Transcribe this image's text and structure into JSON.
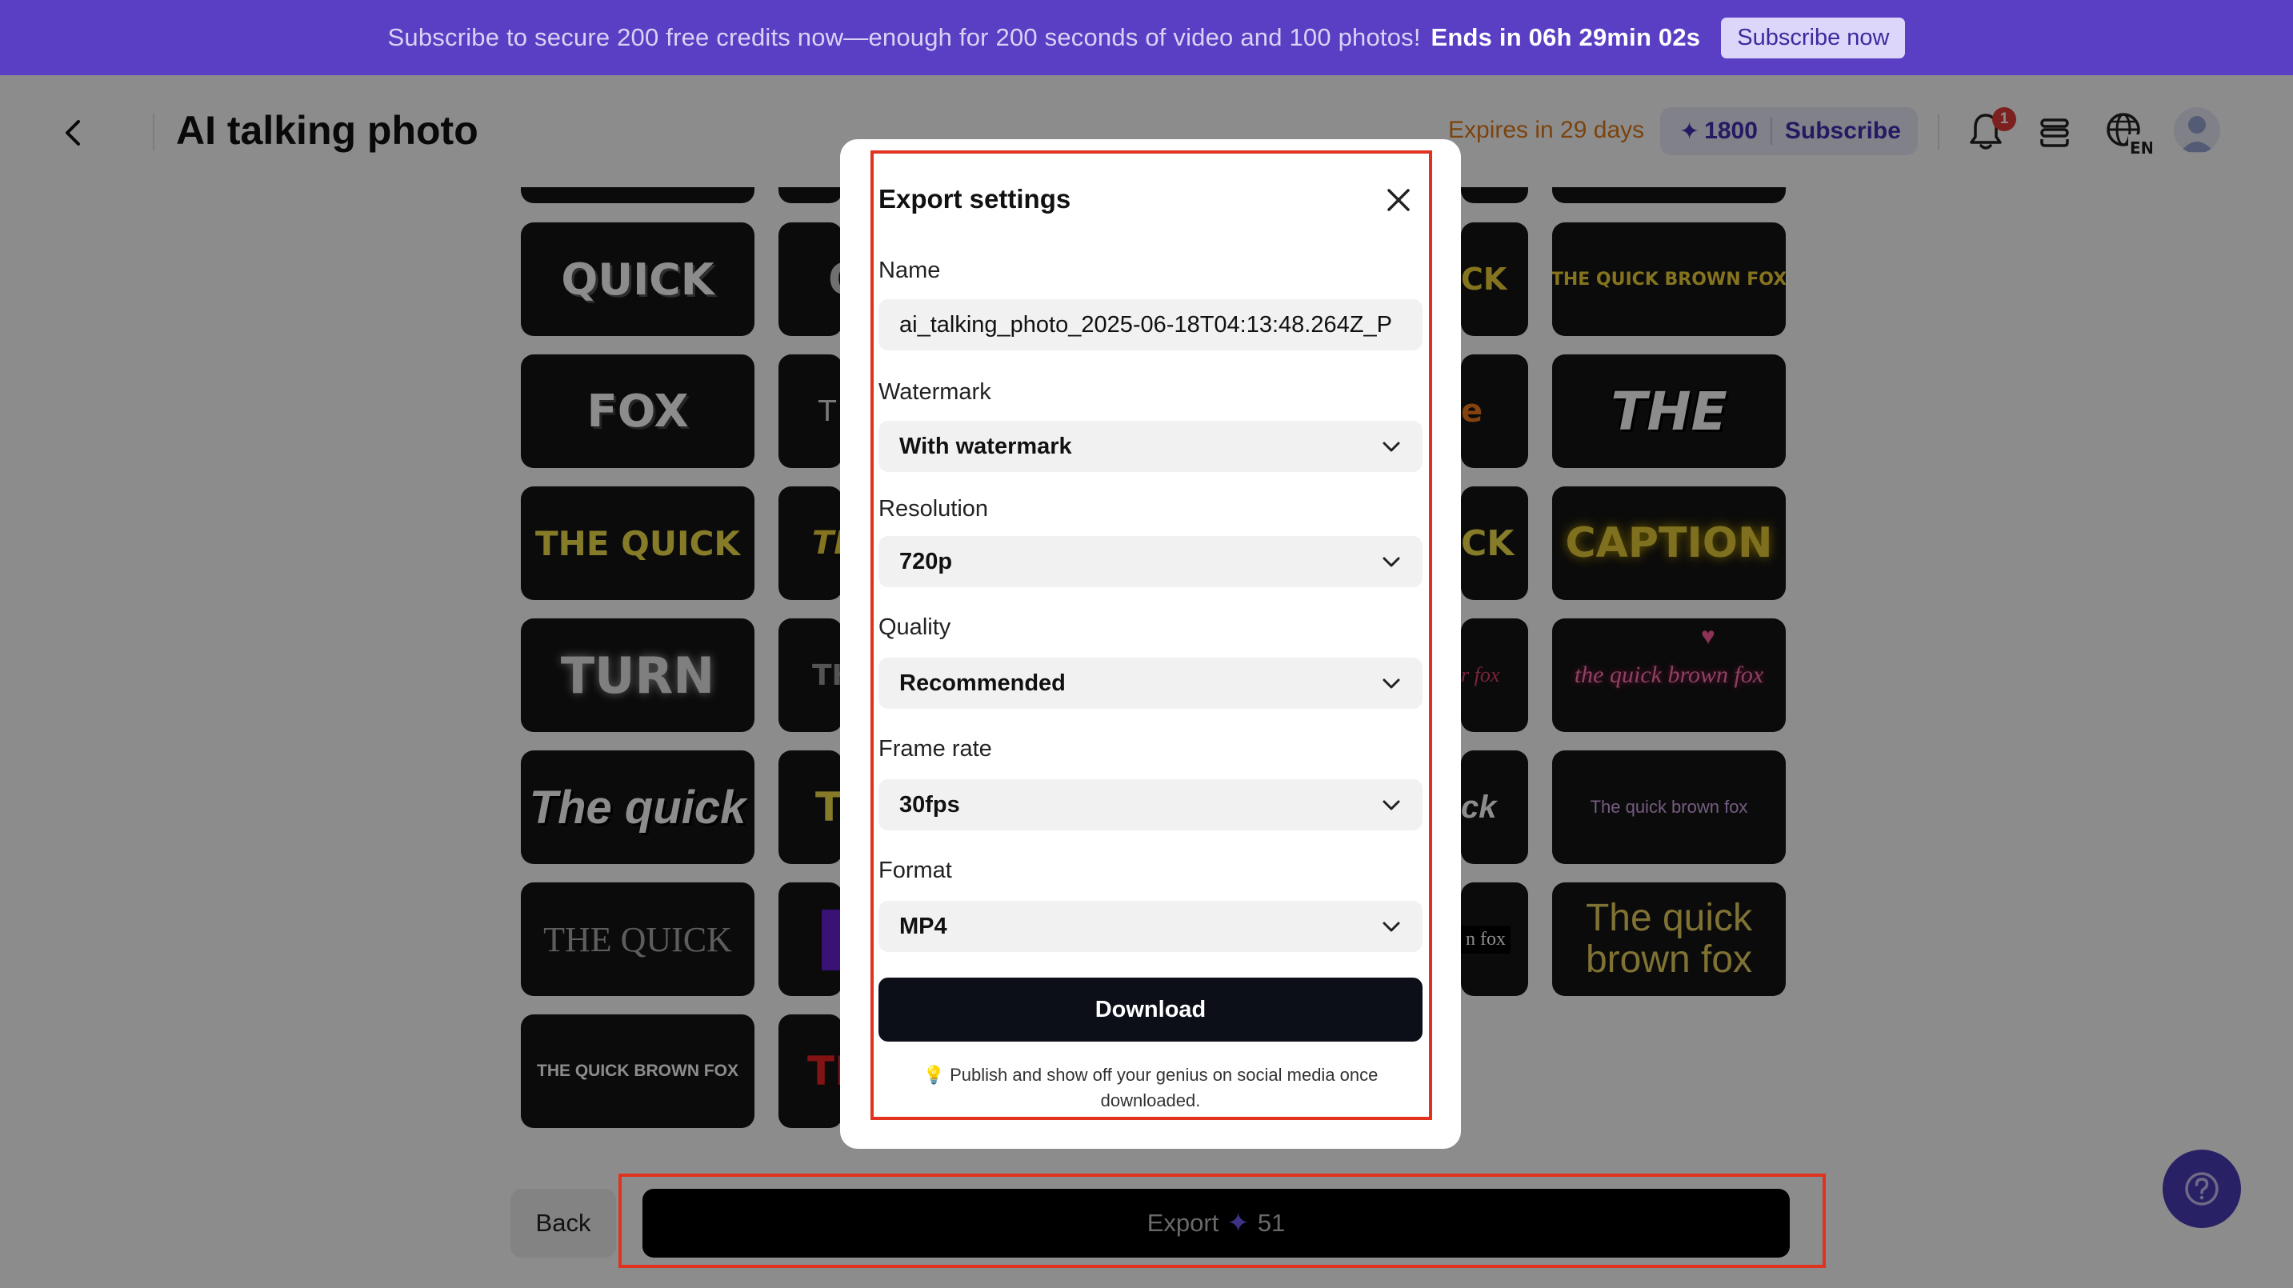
{
  "promo": {
    "text": "Subscribe to secure 200 free credits now—enough for 200 seconds of video and 100 photos!",
    "countdown": "Ends in 06h 29min 02s",
    "button_label": "Subscribe now"
  },
  "header": {
    "title": "AI talking photo",
    "expires": "Expires in 29 days",
    "credits": "1800",
    "subscribe_label": "Subscribe",
    "notification_count": "1"
  },
  "tiles": {
    "col1": [
      "QUICK",
      "FOX",
      "THE QUICK",
      "TURN",
      "The quick",
      "THE QUICK",
      "THE QUICK BROWN FOX"
    ],
    "col2": [
      "Q",
      "T",
      "TH",
      "TH",
      "TH",
      "",
      "TH"
    ],
    "col3": [
      "CK",
      "e",
      "CK",
      "n fox",
      "ck",
      "n fox"
    ],
    "col4": [
      "THE QUICK BROWN FOX",
      "THE",
      "CAPTION",
      "the quick brown fox",
      "The quick brown fox",
      "The quick brown fox"
    ]
  },
  "footer": {
    "back_label": "Back",
    "export_label": "Export",
    "export_cost": "51"
  },
  "modal": {
    "title": "Export settings",
    "name_label": "Name",
    "name_value": "ai_talking_photo_2025-06-18T04:13:48.264Z_P",
    "watermark_label": "Watermark",
    "watermark_value": "With watermark",
    "resolution_label": "Resolution",
    "resolution_value": "720p",
    "quality_label": "Quality",
    "quality_value": "Recommended",
    "framerate_label": "Frame rate",
    "framerate_value": "30fps",
    "format_label": "Format",
    "format_value": "MP4",
    "download_label": "Download",
    "tip": "💡 Publish and show off your genius on social media once downloaded."
  },
  "colors": {
    "promo_bg": "#5a3fc4",
    "accent": "#4330b5",
    "highlight": "#e0321f",
    "expires": "#e07a18"
  }
}
